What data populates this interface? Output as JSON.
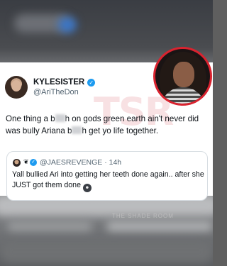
{
  "tweet": {
    "display_name": "KYLESISTER",
    "handle": "@AriTheDon",
    "text_parts": [
      "One thing a b",
      "h on gods green earth ain't never did was bully Ariana b",
      "h get yo life together."
    ]
  },
  "quoted_tweet": {
    "handle": "@JAESREVENGE",
    "time": "· 14h",
    "text": "Yall bullied Ari into getting her teeth done again.. after she JUST got them done"
  },
  "watermark": {
    "main": "TSR",
    "sub": "THE SHADE ROOM"
  },
  "colors": {
    "verified": "#1d9bf0",
    "avatar_border": "#d9232f",
    "text_primary": "#0f1419",
    "text_secondary": "#536471"
  },
  "icons": [
    "verified-badge-icon",
    "heart-icon",
    "emoji-icon"
  ]
}
